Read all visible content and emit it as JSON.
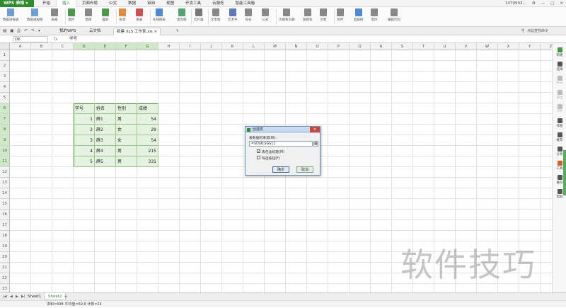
{
  "app": {
    "name": "WPS 表格",
    "account": "1370532...",
    "colors": {
      "brand": "#2e8b2e",
      "selection": "#e6f2e0",
      "accent": "#5ab05a"
    }
  },
  "menu": {
    "items": [
      "开始",
      "插入",
      "页面布局",
      "公式",
      "数据",
      "审阅",
      "视图",
      "开发工具",
      "云服务",
      "智能工具箱"
    ],
    "active": "插入"
  },
  "ribbon": {
    "items": [
      {
        "label": "数据透视表",
        "icon": "pivot-table-icon"
      },
      {
        "label": "数据透视图",
        "icon": "pivot-chart-icon"
      },
      {
        "label": "表格",
        "icon": "table-icon"
      },
      {
        "label": "图片",
        "icon": "image-icon"
      },
      {
        "label": "图库",
        "icon": "gallery-icon"
      },
      {
        "label": "截屏",
        "icon": "screenshot-icon"
      },
      {
        "label": "形状",
        "icon": "shape-icon"
      },
      {
        "label": "图表",
        "icon": "chart-icon"
      },
      {
        "label": "在线图表",
        "icon": "online-chart-icon"
      },
      {
        "label": "迷你图",
        "icon": "sparkline-icon"
      },
      {
        "label": "切片器",
        "icon": "slicer-icon"
      },
      {
        "label": "文本框",
        "icon": "textbox-icon"
      },
      {
        "label": "艺术字",
        "icon": "wordart-icon"
      },
      {
        "label": "符号",
        "icon": "symbol-icon"
      },
      {
        "label": "公式",
        "icon": "formula-icon"
      },
      {
        "label": "页眉和页脚",
        "icon": "header-footer-icon"
      },
      {
        "label": "照相机",
        "icon": "camera-icon"
      },
      {
        "label": "对象",
        "icon": "object-icon"
      },
      {
        "label": "附件",
        "icon": "attachment-icon"
      },
      {
        "label": "超链接",
        "icon": "hyperlink-icon"
      },
      {
        "label": "窗体",
        "icon": "form-icon"
      },
      {
        "label": "编辑代码",
        "icon": "code-icon"
      }
    ]
  },
  "tabs": {
    "items": [
      "我的WPS",
      "云文档",
      "新建 XLS 工作表.xls"
    ],
    "active_index": 2,
    "find_command": "点此查找命令"
  },
  "formula_bar": {
    "cell_ref": "D6",
    "fx": "fx",
    "value": "学号"
  },
  "sheet": {
    "columns": [
      "A",
      "B",
      "C",
      "D",
      "E",
      "F",
      "G",
      "H",
      "I",
      "J",
      "K",
      "L",
      "M",
      "N",
      "O",
      "P",
      "Q",
      "R",
      "S",
      "T",
      "U",
      "V",
      "W",
      "X",
      "Y",
      "Z"
    ],
    "selected_columns": [
      "D",
      "E",
      "F",
      "G"
    ],
    "rows": [
      "1",
      "2",
      "3",
      "4",
      "5",
      "6",
      "7",
      "8",
      "9",
      "10",
      "11",
      "12",
      "13",
      "14",
      "15",
      "16",
      "17",
      "18",
      "19",
      "20",
      "21",
      "22",
      "23"
    ],
    "selected_rows": [
      "6",
      "7",
      "8",
      "9",
      "10",
      "11"
    ],
    "table": {
      "headers": [
        "学号",
        "姓名",
        "性别",
        "成绩"
      ],
      "rows": [
        [
          "1",
          "薛1",
          "男",
          "54"
        ],
        [
          "2",
          "薛2",
          "女",
          "29"
        ],
        [
          "3",
          "薛3",
          "女",
          "54"
        ],
        [
          "4",
          "薛4",
          "男",
          "215"
        ],
        [
          "5",
          "薛5",
          "男",
          "331"
        ]
      ]
    }
  },
  "dialog": {
    "title": "创建表",
    "range_label": "表数据的来源(W):",
    "range_value": "=$D$6:$G$11",
    "has_headers_label": "表包含标题(M)",
    "has_headers_checked": true,
    "filter_label": "筛选按钮(F)",
    "filter_checked": false,
    "ok": "确定",
    "cancel": "取消",
    "close": "×"
  },
  "side_panel": {
    "items": [
      {
        "label": "新建",
        "enabled": true,
        "color": "#3a9a3a"
      },
      {
        "label": "选择",
        "enabled": true,
        "color": "#555555"
      },
      {
        "label": "Mop",
        "enabled": false,
        "color": "#bbbbbb"
      },
      {
        "label": "属性",
        "enabled": false,
        "color": "#bbbbbb"
      },
      {
        "label": "Diff",
        "enabled": false,
        "color": "#bbbbbb"
      },
      {
        "label": "作图",
        "enabled": true,
        "color": "#555555"
      },
      {
        "label": "推荐",
        "enabled": true,
        "color": "#555555"
      },
      {
        "label": "分享",
        "enabled": true,
        "color": "#555555"
      },
      {
        "label": "工具",
        "enabled": true,
        "color": "#e05a2a"
      },
      {
        "label": "备份",
        "enabled": true,
        "color": "#555555"
      },
      {
        "label": "帮助",
        "enabled": true,
        "color": "#555555"
      }
    ]
  },
  "sheets": {
    "items": [
      "Sheet1",
      "Sheet2"
    ],
    "active": "Sheet2",
    "add": "+"
  },
  "status": {
    "text": "求和=698  平均值=69.8  计数=24"
  },
  "watermark": "软件技巧"
}
